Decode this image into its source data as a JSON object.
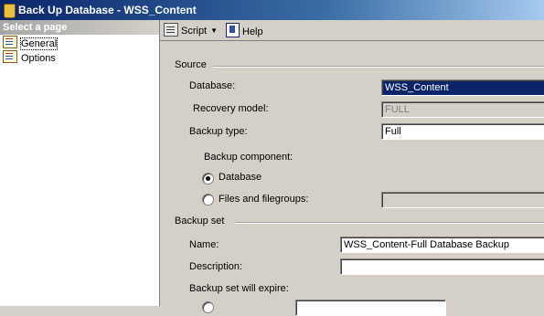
{
  "window": {
    "title": "Back Up Database - WSS_Content"
  },
  "sidebar": {
    "header": "Select a page",
    "pages": [
      {
        "label": "General",
        "selected": true
      },
      {
        "label": "Options",
        "selected": false
      }
    ]
  },
  "toolbar": {
    "script_label": "Script",
    "help_label": "Help"
  },
  "source": {
    "title": "Source",
    "database_label": "Database:",
    "database_value": "WSS_Content",
    "recovery_label": "Recovery model:",
    "recovery_value": "FULL",
    "backup_type_label": "Backup type:",
    "backup_type_value": "Full",
    "component_label": "Backup component:",
    "component_database": "Database",
    "component_files": "Files and filegroups:"
  },
  "backup_set": {
    "title": "Backup set",
    "name_label": "Name:",
    "name_value": "WSS_Content-Full Database Backup",
    "description_label": "Description:",
    "description_value": "",
    "expire_label": "Backup set will expire:"
  }
}
